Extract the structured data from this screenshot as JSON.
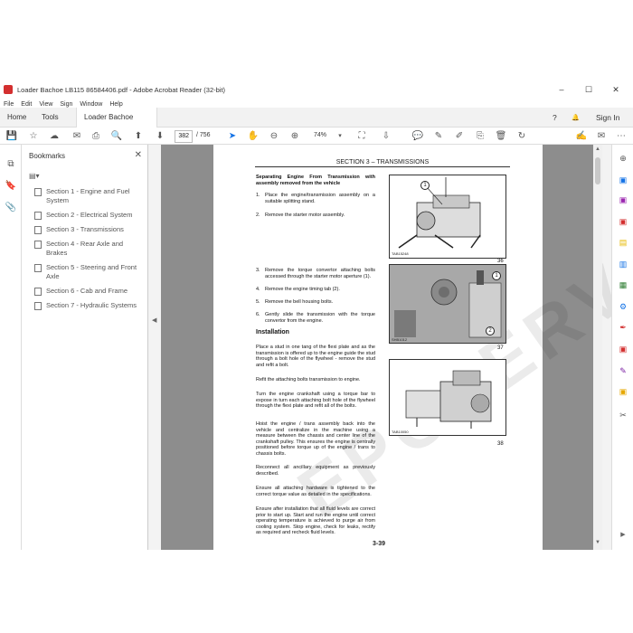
{
  "window": {
    "title": "Loader Bachoe LB115 86584406.pdf - Adobe Acrobat Reader (32-bit)",
    "min": "–",
    "max": "☐",
    "close": "✕"
  },
  "menu": [
    "File",
    "Edit",
    "View",
    "Sign",
    "Window",
    "Help"
  ],
  "tabs": {
    "home": "Home",
    "tools": "Tools",
    "doc": "Loader Bachoe LB1...",
    "doc_close": "×",
    "help": "?",
    "bell": "🔔",
    "signin": "Sign In"
  },
  "toolbar": {
    "page_current": "382",
    "page_total": "/ 756",
    "zoom": "74%"
  },
  "bookmarks": {
    "title": "Bookmarks",
    "close": "✕",
    "options": "▤▾",
    "items": [
      "Section 1 - Engine and Fuel System",
      "Section 2 - Electrical System",
      "Section 3 - Transmissions",
      "Section 4 - Rear Axle and Brakes",
      "Section 5 - Steering and Front Axle",
      "Section 6 - Cab and Frame",
      "Section 7 - Hydraulic Systems"
    ]
  },
  "doc": {
    "header": "SECTION 3 – TRANSMISSIONS",
    "heading1": "Separating Engine From Transmission with assembly removed from the vehicle",
    "steps": [
      {
        "n": "1.",
        "t": "Place the engine/transmission assembly on a suitable splitting stand."
      },
      {
        "n": "2.",
        "t": "Remove the starter motor assembly."
      },
      {
        "n": "3.",
        "t": "Remove the torque convertor attaching bolts accessed through the starter motor aperture (1)."
      },
      {
        "n": "4.",
        "t": "Remove the engine timing tab (2)."
      },
      {
        "n": "5.",
        "t": "Remove the bell housing bolts."
      },
      {
        "n": "6.",
        "t": "Gently slide the transmission with the torque convertor from the engine."
      }
    ],
    "installation": "Installation",
    "paras": [
      "Place a stud in one tang of the flexi plate and as the transmission is offered up to the engine guide the stud through a bolt hole of the flywheel - remove the stud and refit a bolt.",
      "Refit the attaching bolts transmission to engine.",
      "Turn the engine crankshaft using a torque bar to expose in turn each attaching bolt hole of the flywheel through the flexi plate and refit all of the bolts.",
      "Hoist the engine / trans assembly back into the vehicle and centralize in the machine using a measure between the chassis and center line of the crankshaft pulley. This ensures the engine is centrally positioned before torque up of the engine / trans to chassis bolts.",
      "Reconnect all ancillary equipment as previously described.",
      "Ensure all attaching hardware is tightened to the correct torque value as detailed in the specifications.",
      "Ensure after installation that all fluid levels are correct prior to start up. Start and run the engine until correct operating temperature is achieved to purge air from cooling system. Stop engine, check for leaks, rectify as required and recheck fluid levels."
    ],
    "figs": [
      {
        "cap": "TAB15248",
        "num": "36",
        "callout": "1"
      },
      {
        "cap": "SHB1012",
        "num": "37",
        "callout": "2"
      },
      {
        "cap": "TAB10050",
        "num": "38"
      }
    ],
    "page_number": "3-39",
    "watermark": "EPCSERV.COM"
  }
}
